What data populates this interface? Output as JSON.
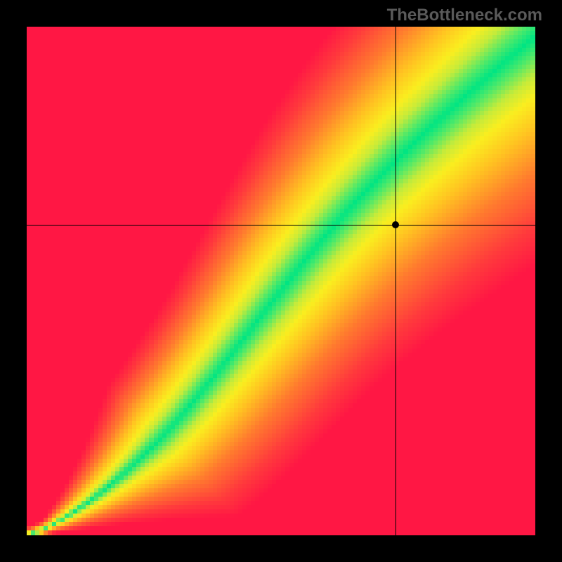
{
  "watermark": "TheBottleneck.com",
  "chart_data": {
    "type": "heatmap",
    "title": "",
    "xlabel": "",
    "ylabel": "",
    "xlim": [
      0,
      100
    ],
    "ylim": [
      0,
      100
    ],
    "grid_size": 120,
    "crosshair": {
      "x": 72.5,
      "y": 61
    },
    "marker": {
      "x": 72.5,
      "y": 61
    },
    "optimal_curve_desc": "nonlinear ridge from bottom-left to top-right, slight S-bend",
    "color_stops": [
      {
        "t": 0.0,
        "color": "#00e583"
      },
      {
        "t": 0.06,
        "color": "#4de96a"
      },
      {
        "t": 0.14,
        "color": "#c6eb3a"
      },
      {
        "t": 0.22,
        "color": "#faee1f"
      },
      {
        "t": 0.35,
        "color": "#ffc321"
      },
      {
        "t": 0.55,
        "color": "#ff7a2e"
      },
      {
        "t": 0.8,
        "color": "#ff3a3c"
      },
      {
        "t": 1.0,
        "color": "#ff1744"
      }
    ]
  }
}
